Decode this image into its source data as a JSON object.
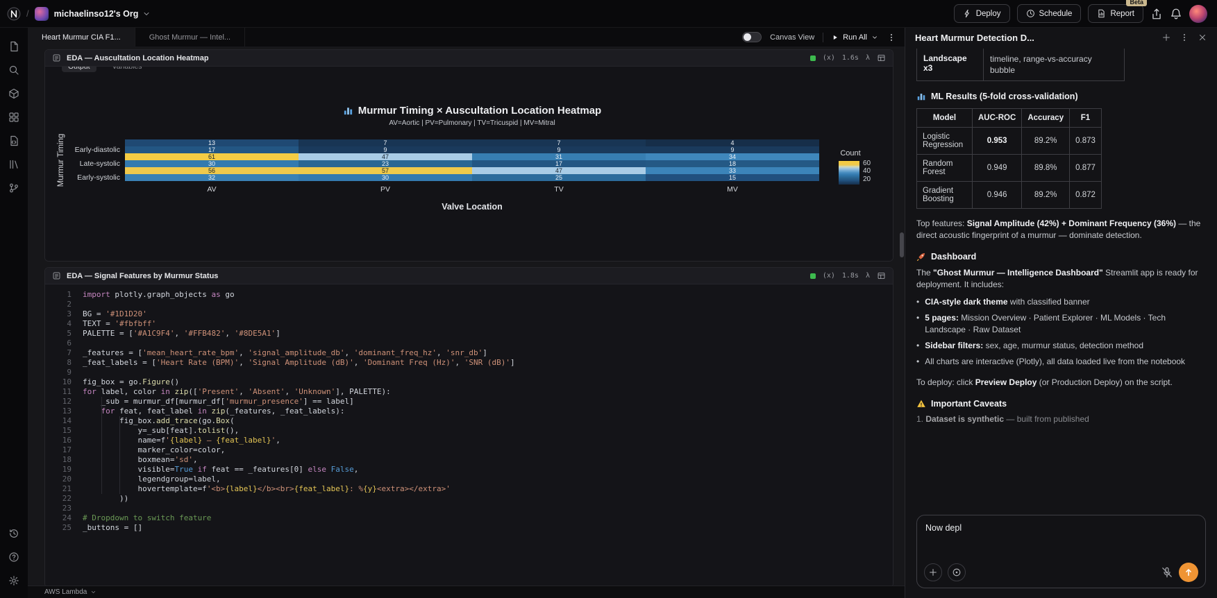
{
  "topbar": {
    "org_name": "michaelinso12's Org",
    "deploy": "Deploy",
    "schedule": "Schedule",
    "report": "Report",
    "beta": "Beta"
  },
  "sidebar": {
    "top_icons": [
      "pages",
      "search",
      "blocks",
      "integrations",
      "file-code",
      "library",
      "git-branch"
    ],
    "bottom_icons": [
      "history",
      "help",
      "settings"
    ]
  },
  "tabbar": {
    "tabs": [
      {
        "label": "Heart Murmur CIA F1...",
        "active": true
      },
      {
        "label": "Ghost Murmur — Intel...",
        "active": false
      }
    ],
    "canvas_view": "Canvas View",
    "run_all": "Run All"
  },
  "notebook": {
    "heatmap_cell": {
      "title": "EDA — Auscultation Location Heatmap",
      "exec_time": "1.6s",
      "output_tab": "Output",
      "variables_tab": "Variables"
    },
    "code_cell": {
      "title": "EDA — Signal Features by Murmur Status",
      "exec_time": "1.8s",
      "lines": [
        "import plotly.graph_objects as go",
        "",
        "BG = '#1D1D20'",
        "TEXT = '#fbfbff'",
        "PALETTE = ['#A1C9F4', '#FFB482', '#8DE5A1']",
        "",
        "_features = ['mean_heart_rate_bpm', 'signal_amplitude_db', 'dominant_freq_hz', 'snr_db']",
        "_feat_labels = ['Heart Rate (BPM)', 'Signal Amplitude (dB)', 'Dominant Freq (Hz)', 'SNR (dB)']",
        "",
        "fig_box = go.Figure()",
        "for label, color in zip(['Present', 'Absent', 'Unknown'], PALETTE):",
        "    _sub = murmur_df[murmur_df['murmur_presence'] == label]",
        "    for feat, feat_label in zip(_features, _feat_labels):",
        "        fig_box.add_trace(go.Box(",
        "            y=_sub[feat].tolist(),",
        "            name=f'{label} — {feat_label}',",
        "            marker_color=color,",
        "            boxmean='sd',",
        "            visible=True if feat == _features[0] else False,",
        "            legendgroup=label,",
        "            hovertemplate=f'<b>{label}</b><br>{feat_label}: %{y}<extra></extra>'",
        "        ))",
        "",
        "# Dropdown to switch feature",
        "_buttons = []"
      ]
    },
    "environment": "AWS Lambda"
  },
  "chart_data": {
    "type": "heatmap",
    "title": "Murmur Timing × Auscultation Location Heatmap",
    "subtitle": "AV=Aortic | PV=Pulmonary | TV=Tricuspid | MV=Mitral",
    "xlabel": "Valve Location",
    "ylabel": "Murmur Timing",
    "x_categories": [
      "AV",
      "PV",
      "TV",
      "MV"
    ],
    "y_tick_labels": [
      "",
      "Early-diastolic",
      "",
      "Late-systolic",
      "",
      "Early-systolic"
    ],
    "values": [
      [
        13,
        7,
        7,
        4
      ],
      [
        17,
        9,
        9,
        9
      ],
      [
        61,
        47,
        31,
        34
      ],
      [
        30,
        23,
        17,
        18
      ],
      [
        56,
        57,
        47,
        33
      ],
      [
        32,
        30,
        25,
        15
      ]
    ],
    "colorbar_title": "Count",
    "colorbar_ticks": [
      60,
      40,
      20
    ],
    "value_range": [
      5,
      65
    ],
    "legend_position": "right",
    "grid": false
  },
  "panel": {
    "title": "Heart Murmur Detection D...",
    "fragment_row": {
      "left": "Landscape x3",
      "right": "timeline, range-vs-accuracy bubble"
    },
    "ml_heading": "ML Results (5-fold cross-validation)",
    "ml_table": {
      "columns": [
        "Model",
        "AUC-ROC",
        "Accuracy",
        "F1"
      ],
      "rows": [
        [
          "Logistic Regression",
          "0.953",
          "89.2%",
          "0.873"
        ],
        [
          "Random Forest",
          "0.949",
          "89.8%",
          "0.877"
        ],
        [
          "Gradient Boosting",
          "0.946",
          "89.2%",
          "0.872"
        ]
      ],
      "bold_cells": [
        [
          0,
          1
        ]
      ]
    },
    "top_features": [
      {
        "t": "Top features: "
      },
      {
        "t": "Signal Amplitude (42%) + Dominant Frequency (36%)",
        "b": true
      },
      {
        "t": " — the direct acoustic fingerprint of a murmur — dominate detection."
      }
    ],
    "dashboard_heading": "Dashboard",
    "dashboard_intro": [
      {
        "t": "The "
      },
      {
        "t": "\"Ghost Murmur — Intelligence Dashboard\"",
        "b": true
      },
      {
        "t": " Streamlit app is ready for deployment. It includes:"
      }
    ],
    "bullets": [
      [
        {
          "t": "CIA-style dark theme",
          "b": true
        },
        {
          "t": " with classified banner"
        }
      ],
      [
        {
          "t": "5 pages:",
          "b": true
        },
        {
          "t": " Mission Overview · Patient Explorer · ML Models · Tech Landscape · Raw Dataset"
        }
      ],
      [
        {
          "t": "Sidebar filters:",
          "b": true
        },
        {
          "t": " sex, age, murmur status, detection method"
        }
      ],
      [
        {
          "t": "All charts are interactive (Plotly), all data loaded live from the notebook"
        }
      ]
    ],
    "deploy_note": [
      {
        "t": "To deploy: click "
      },
      {
        "t": "Preview Deploy",
        "b": true
      },
      {
        "t": " (or Production Deploy) on the script."
      }
    ],
    "caveats_heading": "Important Caveats",
    "caveat_item": [
      {
        "t": "1. "
      },
      {
        "t": "Dataset is synthetic",
        "b": true
      },
      {
        "t": " — built from published"
      }
    ],
    "chat": {
      "value": "Now depl"
    }
  },
  "icons_text": {
    "variables": "(x)",
    "lambda": "λ"
  },
  "colors": {
    "accent_send": "#ef9434",
    "run_success": "#3dba4e",
    "heat_low": "#13253a",
    "heat_high": "#f7ce3e"
  }
}
